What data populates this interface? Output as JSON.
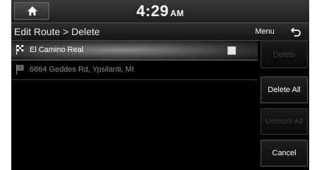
{
  "status_bar": {
    "time": "4:29",
    "ampm": "AM"
  },
  "title_bar": {
    "title": "Edit Route > Delete",
    "menu_label": "Menu"
  },
  "route_list": [
    {
      "label": "El Camino Real",
      "checked": true
    },
    {
      "label": "6864 Geddes Rd, Ypsilanti, MI",
      "checked": false
    }
  ],
  "side_buttons": {
    "delete_label": "Delete",
    "delete_all_label": "Delete All",
    "unmark_all_label": "Unmark All",
    "cancel_label": "Cancel"
  },
  "icons": {
    "home": "home-icon",
    "back": "back-arrow-icon",
    "destination": "checkered-flag-icon",
    "waypoint": "waypoint-flag-icon"
  },
  "colors": {
    "background": "#000000",
    "text": "#ffffff",
    "disabled_text": "#3c3c3c",
    "dim_text": "#8a8a8a"
  }
}
